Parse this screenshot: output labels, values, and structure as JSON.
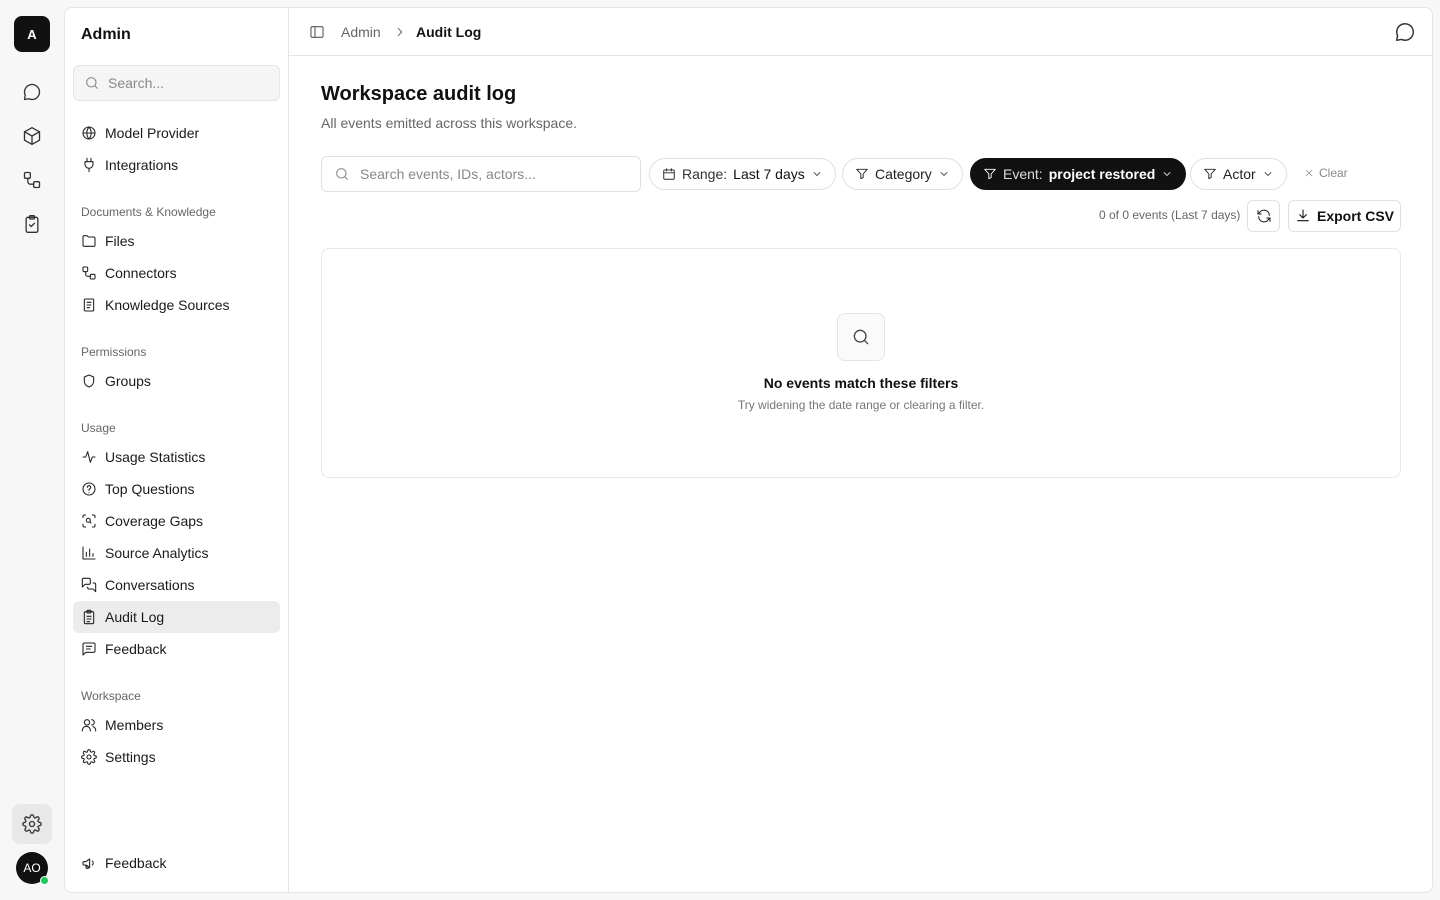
{
  "rail": {
    "logo": "A",
    "avatar": "AO",
    "items": [
      {
        "icon": "chat-icon"
      },
      {
        "icon": "cube-icon"
      },
      {
        "icon": "workflow-icon"
      },
      {
        "icon": "clipboard-check-icon"
      }
    ],
    "settings_icon": "gear-icon"
  },
  "sidebar": {
    "title": "Admin",
    "search_placeholder": "Search...",
    "top_items": [
      {
        "label": "Model Provider",
        "icon": "globe-icon"
      },
      {
        "label": "Integrations",
        "icon": "plug-icon"
      }
    ],
    "sections": [
      {
        "title": "Documents & Knowledge",
        "items": [
          {
            "label": "Files",
            "icon": "folder-icon"
          },
          {
            "label": "Connectors",
            "icon": "connectors-icon"
          },
          {
            "label": "Knowledge Sources",
            "icon": "book-icon"
          }
        ]
      },
      {
        "title": "Permissions",
        "items": [
          {
            "label": "Groups",
            "icon": "shield-icon"
          }
        ]
      },
      {
        "title": "Usage",
        "items": [
          {
            "label": "Usage Statistics",
            "icon": "activity-icon"
          },
          {
            "label": "Top Questions",
            "icon": "question-circle-icon"
          },
          {
            "label": "Coverage Gaps",
            "icon": "scan-search-icon"
          },
          {
            "label": "Source Analytics",
            "icon": "bar-chart-icon"
          },
          {
            "label": "Conversations",
            "icon": "messages-icon"
          },
          {
            "label": "Audit Log",
            "icon": "clipboard-list-icon",
            "active": true
          },
          {
            "label": "Feedback",
            "icon": "message-square-text-icon"
          }
        ]
      },
      {
        "title": "Workspace",
        "items": [
          {
            "label": "Members",
            "icon": "users-icon"
          },
          {
            "label": "Settings",
            "icon": "gear-icon"
          }
        ]
      }
    ],
    "footer_label": "Feedback"
  },
  "breadcrumb": {
    "parent": "Admin",
    "current": "Audit Log"
  },
  "page": {
    "title": "Workspace audit log",
    "subtitle": "All events emitted across this workspace."
  },
  "filters": {
    "search_placeholder": "Search events, IDs, actors...",
    "range_label": "Range:",
    "range_value": "Last 7 days",
    "category_label": "Category",
    "event_label": "Event:",
    "event_value": "project restored",
    "actor_label": "Actor",
    "clear_label": "Clear"
  },
  "results": {
    "count_text": "0 of 0 events (Last 7 days)",
    "export_label": "Export CSV",
    "empty_title": "No events match these filters",
    "empty_subtitle": "Try widening the date range or clearing a filter."
  },
  "colors": {
    "accent": "#111111",
    "presence": "#22c55e",
    "active_item_bg": "#ececec"
  }
}
